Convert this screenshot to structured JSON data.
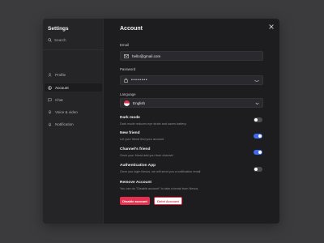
{
  "sidebar": {
    "title": "Settings",
    "search_label": "Search",
    "items": [
      {
        "label": "Profile",
        "icon": "user-icon"
      },
      {
        "label": "Account",
        "icon": "account-icon",
        "active": true
      },
      {
        "label": "Chat",
        "icon": "chat-icon"
      },
      {
        "label": "Voice & video",
        "icon": "microphone-icon"
      },
      {
        "label": "Notification",
        "icon": "bell-icon"
      }
    ]
  },
  "main": {
    "title": "Account",
    "email": {
      "label": "Email",
      "value": "hello@gmail.com"
    },
    "password": {
      "label": "Password",
      "value": "••••••••"
    },
    "language": {
      "label": "Language",
      "value": "English"
    },
    "settings": [
      {
        "title": "Dark mode",
        "description": "Dark mode reduces eye strain and saves battery.",
        "enabled": false
      },
      {
        "title": "New friend",
        "description": "Let your friend find your account",
        "enabled": true
      },
      {
        "title": "Channel's friend",
        "description": "Once your friend add you from channel",
        "enabled": true
      },
      {
        "title": "Authentication App",
        "description": "Once you login Nexus, we will send you a notification email",
        "enabled": false
      }
    ],
    "remove": {
      "title": "Remove Account",
      "description": "You can do \"Disable account\" to take a break from Nexus.",
      "disable_label": "Disable account",
      "delete_label": "Delet Account"
    }
  },
  "colors": {
    "accent": "#3d6bf0",
    "danger": "#e3314f",
    "panel": "#1d1d20",
    "sidebar": "#252528"
  }
}
